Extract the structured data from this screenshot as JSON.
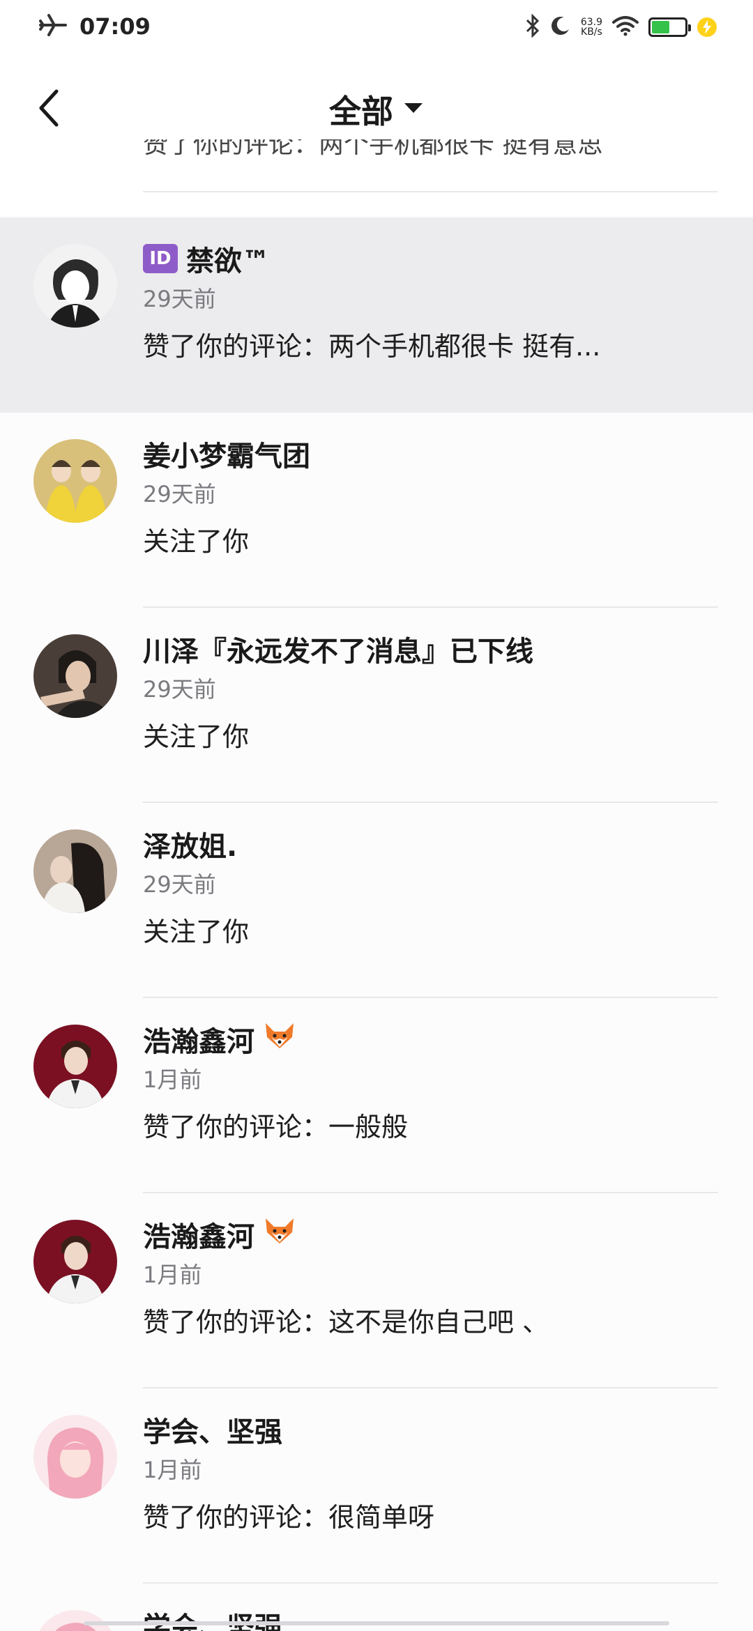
{
  "status_bar": {
    "time": "07:09",
    "net_speed_value": "63.9",
    "net_speed_unit": "KB/s",
    "battery_level": 0.5,
    "battery_color": "#35c24a"
  },
  "header": {
    "title": "全部"
  },
  "partial_top_row": {
    "text": "赞了你的评论：两个手机都很卡 挺有意思"
  },
  "items": [
    {
      "name": "禁欲™",
      "has_id_badge": true,
      "id_badge_label": "ID",
      "time": "29天前",
      "action": "赞了你的评论：两个手机都很卡 挺有...",
      "highlighted": true,
      "avatar_color": "#f2f2f2"
    },
    {
      "name": "姜小梦霸气团",
      "time": "29天前",
      "action": "关注了你",
      "avatar_color": "#e4c84a"
    },
    {
      "name": "川泽『永远发不了消息』已下线",
      "time": "29天前",
      "action": "关注了你",
      "avatar_color": "#3b3532"
    },
    {
      "name": "泽放姐.",
      "time": "29天前",
      "action": "关注了你",
      "avatar_color": "#c9b7a6"
    },
    {
      "name": "浩瀚鑫河",
      "has_fox": true,
      "time": "1月前",
      "action": "赞了你的评论：一般般",
      "avatar_color": "#7a1022"
    },
    {
      "name": "浩瀚鑫河",
      "has_fox": true,
      "time": "1月前",
      "action": "赞了你的评论：这不是你自己吧 、",
      "avatar_color": "#7a1022"
    },
    {
      "name": "学会、坚强",
      "time": "1月前",
      "action": "赞了你的评论：很简单呀",
      "avatar_color": "#f4c9d2"
    }
  ],
  "bottom_partial": {
    "name": "学会、坚强",
    "avatar_color": "#f4c9d2"
  }
}
